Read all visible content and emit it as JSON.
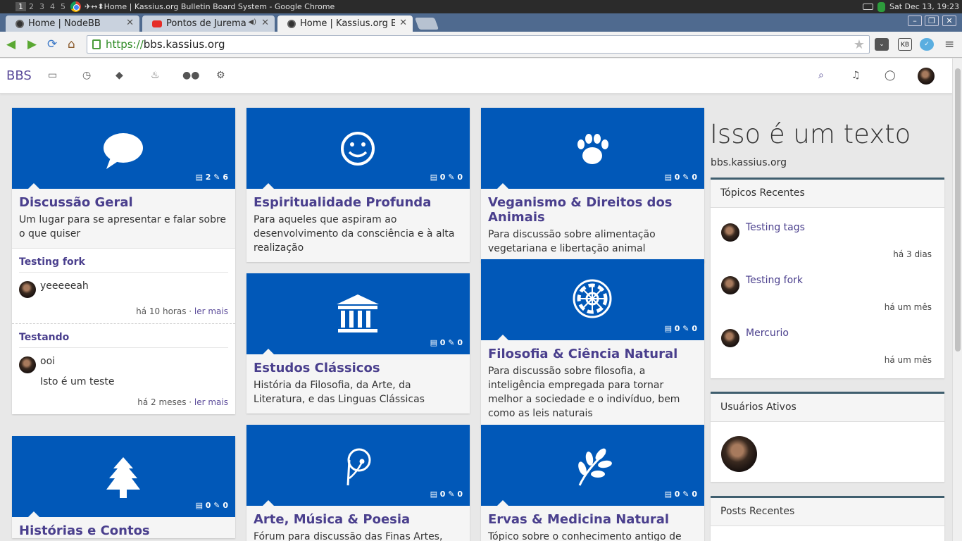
{
  "wm": {
    "workspaces": [
      "1",
      "2",
      "3",
      "4",
      "5"
    ],
    "title": "✈↔⬍Home | Kassius.org Bulletin Board System - Google Chrome",
    "datetime": "Sat Dec 13, 19:23"
  },
  "tabs": [
    {
      "label": "Home | NodeBB"
    },
    {
      "label": "Pontos de Jurema"
    },
    {
      "label": "Home | Kassius.org B"
    }
  ],
  "address": {
    "scheme": "https://",
    "host": "bbs.kassius.org"
  },
  "nav": {
    "brand": "BBS",
    "icons": [
      "inbox-icon",
      "clock-icon",
      "tags-icon",
      "fire-icon",
      "users-icon",
      "gears-icon"
    ],
    "right_icons": [
      "search-icon",
      "bell-icon",
      "chat-icon"
    ]
  },
  "categories": [
    {
      "title": "Discussão Geral",
      "description": "Um lugar para se apresentar e falar sobre o que quiser",
      "icon": "speech-bubble-icon",
      "topics": "2",
      "posts": "6",
      "teasers": [
        {
          "title": "Testing fork",
          "posts": [
            "yeeeeeah"
          ],
          "time": "há 10 horas",
          "more": "ler mais"
        },
        {
          "title": "Testando",
          "posts": [
            "ooi",
            "Isto é um teste"
          ],
          "time": "há 2 meses",
          "more": "ler mais"
        }
      ]
    },
    {
      "title": "Espiritualidade Profunda",
      "description": "Para aqueles que aspiram ao desenvolvimento da consciência e à alta realização",
      "icon": "smile-icon",
      "topics": "0",
      "posts": "0"
    },
    {
      "title": "Veganismo & Direitos dos Animais",
      "description": "Para discussão sobre alimentação vegetariana e libertação animal",
      "icon": "paw-icon",
      "topics": "0",
      "posts": "0"
    },
    {
      "title": "Estudos Clássicos",
      "description": "História da Filosofia, da Arte, da Literatura, e das Linguas Clássicas",
      "icon": "columns-icon",
      "topics": "0",
      "posts": "0"
    },
    {
      "title": "Filosofia & Ciência Natural",
      "description": "Para discussão sobre filosofia, a inteligência empregada para tornar melhor a sociedade e o indivíduo, bem como as leis naturais",
      "icon": "empire-icon",
      "topics": "0",
      "posts": "0"
    },
    {
      "title": "Histórias e Contos",
      "description": "",
      "icon": "tree-icon",
      "topics": "0",
      "posts": "0"
    },
    {
      "title": "Arte, Música & Poesia",
      "description": "Fórum para discussão das Finas Artes,",
      "icon": "pied-piper-icon",
      "topics": "0",
      "posts": "0"
    },
    {
      "title": "Ervas & Medicina Natural",
      "description": "Tópico sobre o conhecimento antigo de",
      "icon": "leaf-icon",
      "topics": "0",
      "posts": "0"
    }
  ],
  "sidebar": {
    "heading": "Isso é um texto",
    "subtext": "bbs.kassius.org",
    "recent_topics": {
      "title": "Tópicos Recentes",
      "items": [
        {
          "title": "Testing tags",
          "time": "há 3 dias"
        },
        {
          "title": "Testing fork",
          "time": "há um mês"
        },
        {
          "title": "Mercurio",
          "time": "há um mês"
        }
      ]
    },
    "active_users": {
      "title": "Usuários Ativos"
    },
    "recent_posts": {
      "title": "Posts Recentes"
    }
  },
  "colors": {
    "category_bg": "#0158b8",
    "accent": "#4a3f8d"
  }
}
